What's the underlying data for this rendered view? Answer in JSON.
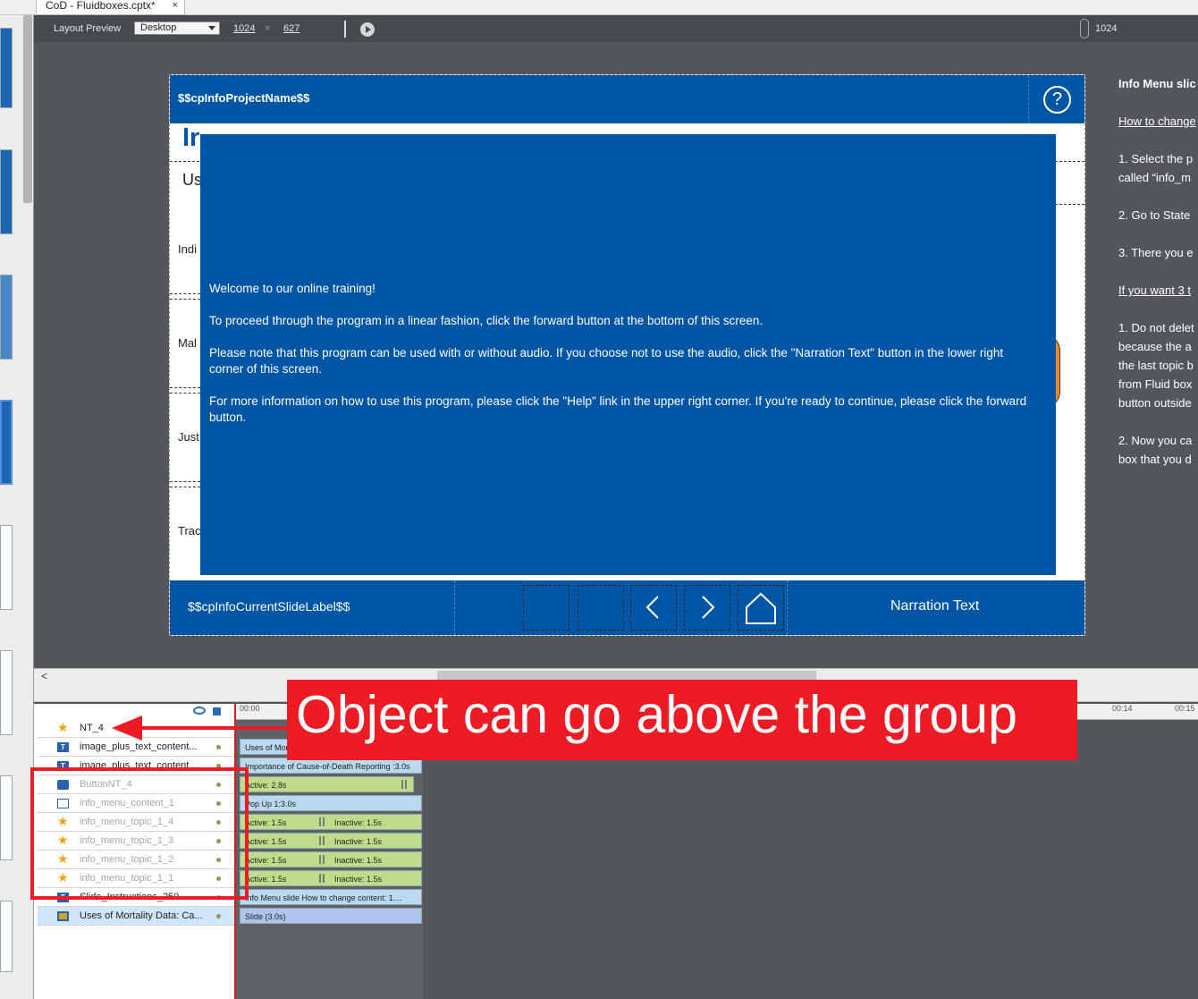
{
  "tab": {
    "title": "CoD - Fluidboxes.cptx*",
    "close": "×"
  },
  "toolbar": {
    "label": "Layout Preview",
    "device": "Desktop",
    "width": "1024",
    "times": "×",
    "height": "627",
    "ruler_value": "1024"
  },
  "slide": {
    "header_var": "$$cpInfoProjectName$$",
    "help": "?",
    "title_fragment": "Ir",
    "subtitle_fragment": "Us",
    "row_labels": [
      "Indi",
      "Mal",
      "Just",
      "Trac"
    ],
    "popup": {
      "p1": "Welcome to our online training!",
      "p2": "To proceed through the program in a linear fashion, click the forward button at the bottom of this screen.",
      "p3": "Please note that this program can be used with or without audio.  If you choose not to use the audio, click the \"Narration Text\" button in the lower right corner of this screen.",
      "p4": "For more information on how to use this program, please click the \"Help\" link in the upper right corner.  If you're ready to continue, please click the forward button."
    },
    "footer_var": "$$cpInfoCurrentSlideLabel$$",
    "prev_glyph": "‹",
    "next_glyph": "›",
    "narration": "Narration Text"
  },
  "notes": {
    "heading": "Info Menu slic",
    "link1": "How to change",
    "s1": "1. Select the p",
    "s1b": "called “info_m",
    "s2": "2. Go to State",
    "s3": "3. There you e",
    "link2": "If you want 3 t",
    "t1": "1. Do not delet",
    "t1b": "because the a",
    "t1c": "the last topic b",
    "t1d": "from Fluid box",
    "t1e": "button outside",
    "t2": "2. Now you ca",
    "t2b": "box that you d"
  },
  "scroll": {
    "left_arrow": "<"
  },
  "timeline": {
    "ruler": [
      "00:00",
      "00:14",
      "00:15"
    ],
    "layers": [
      {
        "name": "NT_4",
        "icon": "star-icon",
        "dim": false,
        "sel": false
      },
      {
        "name": "image_plus_text_content...",
        "icon": "text-icon",
        "dim": false,
        "sel": false
      },
      {
        "name": "image_plus_text_content...",
        "icon": "text-icon",
        "dim": false,
        "sel": false
      },
      {
        "name": "ButtonNT_4",
        "icon": "button-icon",
        "dim": true,
        "sel": false
      },
      {
        "name": "info_menu_content_1",
        "icon": "image-icon",
        "dim": true,
        "sel": false
      },
      {
        "name": "info_menu_topic_1_4",
        "icon": "star-icon",
        "dim": true,
        "sel": false
      },
      {
        "name": "info_menu_topic_1_3",
        "icon": "star-icon",
        "dim": true,
        "sel": false
      },
      {
        "name": "info_menu_topic_1_2",
        "icon": "star-icon",
        "dim": true,
        "sel": false
      },
      {
        "name": "info_menu_topic_1_1",
        "icon": "star-icon",
        "dim": true,
        "sel": false
      },
      {
        "name": "Slide_Instructions_250",
        "icon": "text-icon",
        "dim": false,
        "sel": false
      },
      {
        "name": "Uses of Mortality Data: Ca...",
        "icon": "slide-icon",
        "dim": false,
        "sel": true
      }
    ],
    "bars": {
      "b1": "Uses of Mor",
      "b2": "Importance of Cause-of-Death Reporting :3.0s",
      "b3": "Active: 2.8s",
      "b4": "Pop Up 1:3.0s",
      "active": "Active: 1.5s",
      "inactive": "Inactive: 1.5s",
      "b9": "Info Menu slide  How to change content:  1....",
      "b10": "Slide (3.0s)"
    }
  },
  "annotation": {
    "banner": "Object can go above the group"
  },
  "colors": {
    "slide_blue": "#0055a5",
    "annotation_red": "#ed1c24",
    "bar_green": "#bfdc8a",
    "bar_blue": "#b8d9ef"
  }
}
